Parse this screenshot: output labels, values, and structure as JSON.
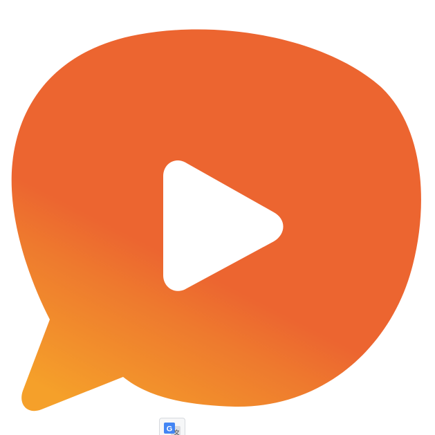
{
  "logo": {
    "icon": "chat-bubble-play-icon",
    "colors": {
      "bubble_top": "#EC6530",
      "bubble_bottom": "#F5A02A",
      "play": "#FFFFFF"
    }
  },
  "translate_button": {
    "icon": "google-translate-icon",
    "colors": {
      "badge": "#4285F4",
      "glyph": "#FFFFFF",
      "secondary": "#DADCE0"
    }
  }
}
